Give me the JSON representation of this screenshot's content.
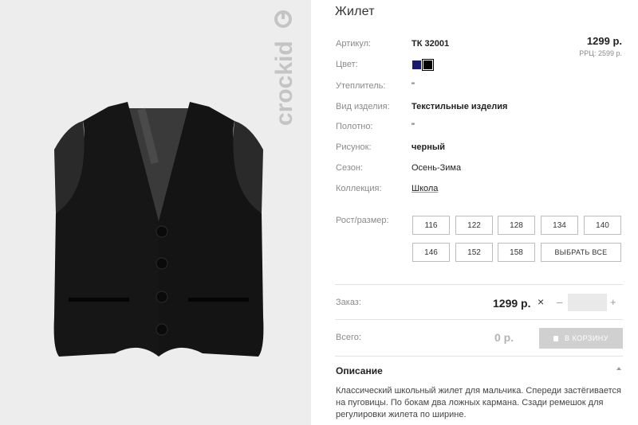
{
  "product": {
    "title": "Жилет",
    "price": "1299 р.",
    "rrp": "РРЦ: 2599 р."
  },
  "specs": {
    "article_label": "Артикул:",
    "article_value": "ТК 32001",
    "color_label": "Цвет:",
    "colors": [
      "#1a1a6e",
      "#000000"
    ],
    "insulation_label": "Утеплитель:",
    "insulation_value": "\"",
    "type_label": "Вид изделия:",
    "type_value": "Текстильные изделия",
    "fabric_label": "Полотно:",
    "fabric_value": "\"",
    "pattern_label": "Рисунок:",
    "pattern_value": "черный",
    "season_label": "Сезон:",
    "season_value": "Осень-Зима",
    "collection_label": "Коллекция:",
    "collection_value": "Школа"
  },
  "sizes": {
    "label": "Рост/размер:",
    "items": [
      "116",
      "122",
      "128",
      "134",
      "140",
      "146",
      "152",
      "158"
    ],
    "select_all": "ВЫБРАТЬ ВСЕ"
  },
  "order": {
    "label": "Заказ:",
    "price": "1299 р.",
    "times": "×",
    "minus": "–",
    "plus": "+",
    "quantity": ""
  },
  "total": {
    "label": "Всего:",
    "value": "0 р.",
    "cart_button": "В КОРЗИНУ"
  },
  "description": {
    "title": "Описание",
    "text": "Классический школьный жилет для мальчика. Спереди застёгивается на пуговицы. По бокам два ложных кармана. Сзади ремешок для регулировки жилета по ширине."
  },
  "brand": {
    "logo_text": "crockid"
  }
}
